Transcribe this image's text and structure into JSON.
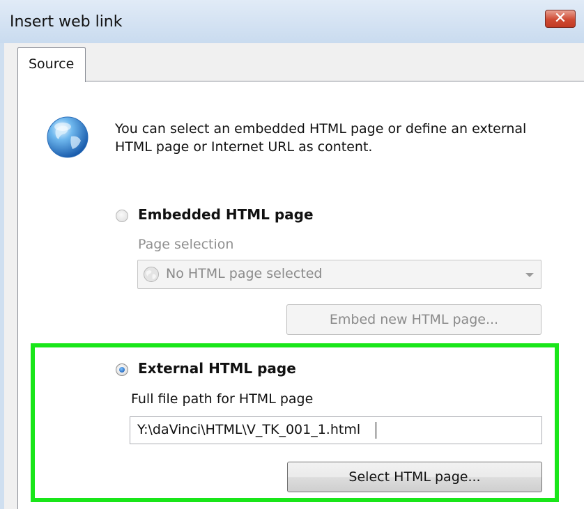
{
  "window": {
    "title": "Insert web link"
  },
  "tabs": [
    {
      "label": "Source"
    }
  ],
  "intro_text": "You can select an embedded HTML page or define an external HTML page or Internet URL as content.",
  "embedded": {
    "label": "Embedded HTML page",
    "selected": false,
    "page_selection_label": "Page selection",
    "combo_value": "No HTML page selected",
    "embed_button": "Embed new HTML page..."
  },
  "external": {
    "label": "External HTML page",
    "selected": true,
    "path_label": "Full file path for HTML page",
    "path_value": "Y:\\daVinci\\HTML\\V_TK_001_1.html",
    "select_button": "Select HTML page..."
  },
  "colors": {
    "highlight": "#19e619",
    "close_button": "#c13a24"
  },
  "icons": {
    "close": "close-icon",
    "globe": "globe-icon"
  }
}
